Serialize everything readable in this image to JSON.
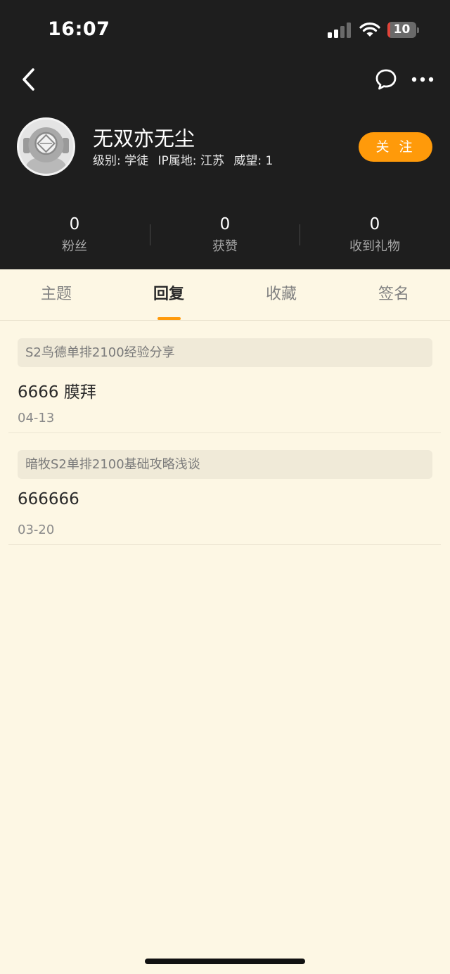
{
  "status_bar": {
    "time": "16:07",
    "battery_level": "10",
    "battery_fraction": 0.1,
    "battery_color": "#e0443a"
  },
  "nav": {
    "back_icon": "chevron-left-icon",
    "comment_icon": "chat-bubble-icon",
    "more_icon": "ellipsis-icon"
  },
  "profile": {
    "avatar_icon": "diving-helmet-avatar",
    "name": "无双亦无尘",
    "level": "级别: 学徒",
    "ip_location": "IP属地: 江苏",
    "prestige": "威望: 1",
    "follow_label": "关 注",
    "accent_color": "#ff9a0a"
  },
  "stats": [
    {
      "value": "0",
      "label": "粉丝"
    },
    {
      "value": "0",
      "label": "获赞"
    },
    {
      "value": "0",
      "label": "收到礼物"
    }
  ],
  "tabs": [
    {
      "label": "主题",
      "active": false
    },
    {
      "label": "回复",
      "active": true
    },
    {
      "label": "收藏",
      "active": false
    },
    {
      "label": "签名",
      "active": false
    }
  ],
  "posts": [
    {
      "topic": "S2鸟德单排2100经验分享",
      "content": "6666 膜拜",
      "date": "04-13"
    },
    {
      "topic": "暗牧S2单排2100基础攻略浅谈",
      "content": "666666",
      "date": "03-20"
    }
  ]
}
